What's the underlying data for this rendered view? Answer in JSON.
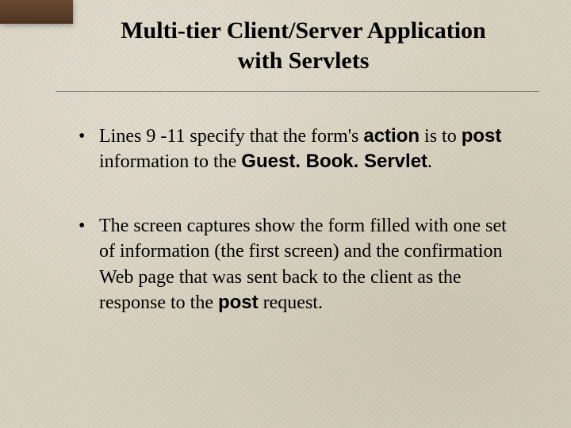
{
  "title_line1": "Multi-tier Client/Server Application",
  "title_line2": "with Servlets",
  "bullets": [
    {
      "t1": "Lines 9 -11 specify that the form's ",
      "b1": "action",
      "t2": " is to ",
      "b2": "post",
      "t3": " information to the ",
      "b3": "Guest. Book. Servlet",
      "t4": "."
    },
    {
      "t1": "The screen captures show the form filled with one set of information (the first screen) and the confirmation Web page that was sent back to the client as the response to the ",
      "b1": "post",
      "t2": " request.",
      "b2": "",
      "t3": "",
      "b3": "",
      "t4": ""
    }
  ]
}
